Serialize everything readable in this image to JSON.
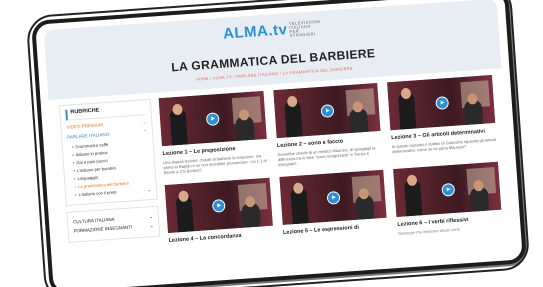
{
  "header": {
    "logo": "ALMA.tv",
    "logo_tag": "TELEVISIONE ITALIANA PER STRANIERI",
    "title": "LA GRAMMATICA DEL BARBIERE",
    "breadcrumb": "HOME / ALMA.TV / PARLARE ITALIANO / LA GRAMMATICA DEL BARBIERE"
  },
  "sidebar": {
    "heading": "RUBRICHE",
    "cat1": "VIDEO PREMIUM",
    "cat2": "PARLARE ITALIANO",
    "items": [
      {
        "label": "Grammatica caffè"
      },
      {
        "label": "Italiano in pratica"
      },
      {
        "label": "Dai e pani pucco"
      },
      {
        "label": "L'italiano per bambini"
      },
      {
        "label": "Linguaggio"
      },
      {
        "label": "La grammatica del barbiere"
      },
      {
        "label": "L'italiano con il prete"
      }
    ],
    "section2": [
      "CULTURA ITALIANA",
      "FORMAZIONE INSEGNANTI"
    ]
  },
  "cards": [
    {
      "title": "Lezione 1 – Le preposizione",
      "desc": "Una doppia lezione: chiede al barbiere la soluzione, ma prima lo Rapido e se non dovrebbe pronunciare : La 1-1 di Benito a Chi Berbes?"
    },
    {
      "title": "Lezione 2 – sono e faccio",
      "desc": "Dovrebbe chiede di un medico Maurizio, di spiegargli la differenza tra le fase \"sono recognizado\" e \"faccio il insegnato\"."
    },
    {
      "title": "Lezione 3 – Gli articoli determinativi",
      "desc": "In questo episodio il dubbio di Giancarlo riguarda gli articoli determinativi: come se ne parla Maurizio?"
    },
    {
      "title": "Lezione 4 – La concordanza",
      "desc": ""
    },
    {
      "title": "Lezione 5 – Le espressioni di",
      "desc": ""
    },
    {
      "title": "Lezione 6 – I verbi riflessivi",
      "desc": "Giuseppe ma imparare alcuni verbi"
    }
  ]
}
